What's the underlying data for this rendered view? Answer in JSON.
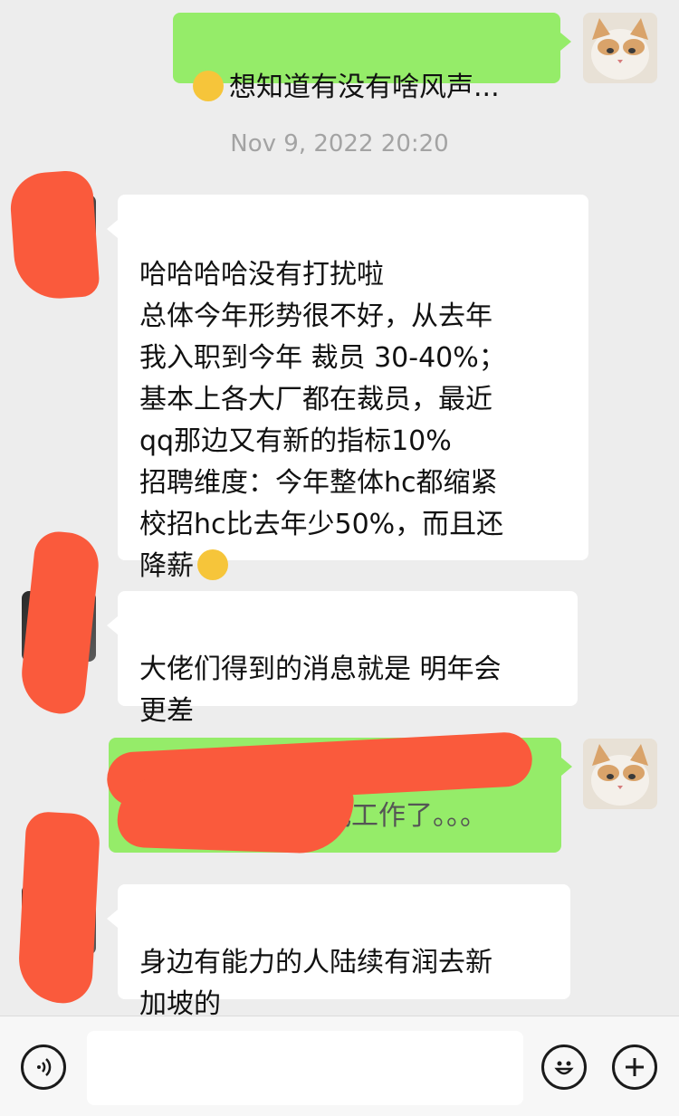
{
  "messages": [
    {
      "side": "out",
      "text": "想知道有没有啥风声..."
    },
    {
      "side": "in",
      "text": "哈哈哈哈没有打扰啦\n总体今年形势很不好，从去年\n我入职到今年 裁员 30-40%；\n基本上各大厂都在裁员，最近\nqq那边又有新的指标10%\n招聘维度：今年整体hc都缩紧\n校招hc比去年少50%，而且还\n降薪"
    },
    {
      "side": "in",
      "text": "大佬们得到的消息就是 明年会\n更差"
    },
    {
      "side": "out",
      "text": "都不好找工作了。。。"
    },
    {
      "side": "in",
      "text": "身边有能力的人陆续有润去新\n加坡的"
    }
  ],
  "timestamp": "Nov 9, 2022 20:20",
  "input": {
    "placeholder": ""
  },
  "icons": {
    "voice": "voice-icon",
    "emoji": "emoji-icon",
    "plus": "plus-icon"
  },
  "colors": {
    "out_bubble": "#95ec69",
    "in_bubble": "#ffffff",
    "background": "#ededed",
    "redaction": "#fa5a3c"
  }
}
